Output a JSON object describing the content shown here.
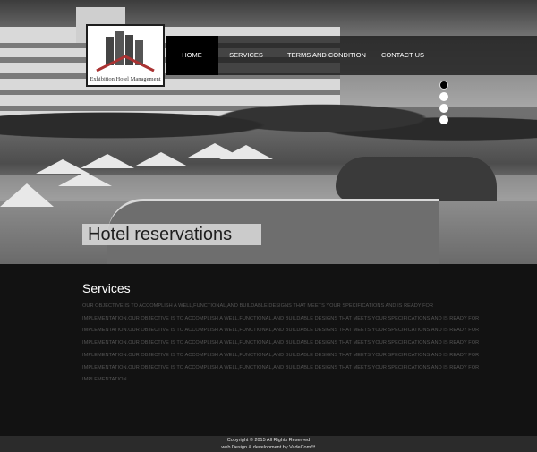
{
  "logo": {
    "company": "Exhibition Hotel Management"
  },
  "nav": {
    "items": [
      {
        "label": "HOME",
        "active": true
      },
      {
        "label": "SERVICES",
        "active": false
      },
      {
        "label": "TERMS AND CONDITION",
        "active": false
      },
      {
        "label": "CONTACT US",
        "active": false
      }
    ]
  },
  "slider": {
    "dots": 4,
    "active_index": 0
  },
  "hero": {
    "caption": "Hotel reservations"
  },
  "services": {
    "title": "Services",
    "text": "OUR OBJECTIVE IS TO ACCOMPLISH A WELL,FUNCTIONAL,AND BUILDABLE DESIGNS THAT MEETS YOUR SPECIFICATIONS AND IS READY FOR IMPLEMENTATION.OUR OBJECTIVE IS TO ACCOMPLISH A WELL,FUNCTIONAL,AND BUILDABLE DESIGNS THAT MEETS YOUR SPECIFICATIONS AND IS READY FOR IMPLEMENTATION.OUR OBJECTIVE IS TO ACCOMPLISH A WELL,FUNCTIONAL,AND BUILDABLE DESIGNS THAT MEETS YOUR SPECIFICATIONS AND IS READY FOR IMPLEMENTATION.OUR OBJECTIVE IS TO ACCOMPLISH A WELL,FUNCTIONAL,AND BUILDABLE DESIGNS THAT MEETS YOUR SPECIFICATIONS AND IS READY FOR IMPLEMENTATION.OUR OBJECTIVE IS TO ACCOMPLISH A WELL,FUNCTIONAL,AND BUILDABLE DESIGNS THAT MEETS YOUR SPECIFICATIONS AND IS READY FOR IMPLEMENTATION.OUR OBJECTIVE IS TO ACCOMPLISH A WELL,FUNCTIONAL,AND BUILDABLE DESIGNS THAT MEETS YOUR SPECIFICATIONS AND IS READY FOR IMPLEMENTATION."
  },
  "footer": {
    "copyright": "Copyright © 2015 All Rights Reserved",
    "credit": "web Design & development by VadeCom™"
  }
}
